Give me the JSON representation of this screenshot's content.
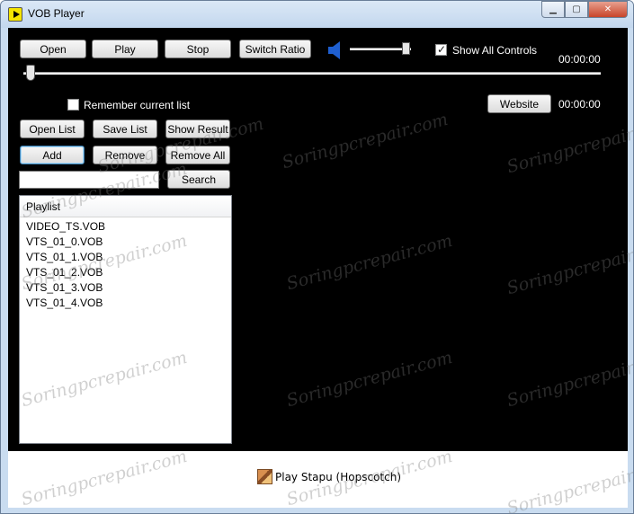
{
  "window": {
    "title": "VOB Player",
    "controls": {
      "minimize": "▁",
      "maximize": "▢",
      "close": "✕"
    }
  },
  "toolbar": {
    "open": "Open",
    "play": "Play",
    "stop": "Stop",
    "switch_ratio": "Switch Ratio",
    "show_all_controls": {
      "label": "Show All Controls",
      "checked": true
    },
    "time_top": "00:00:00",
    "time_bottom": "00:00:00",
    "website": "Website",
    "remember_list": {
      "label": "Remember current list",
      "checked": false
    }
  },
  "list_buttons": {
    "open_list": "Open List",
    "save_list": "Save List",
    "show_result": "Show Result",
    "add": "Add",
    "remove": "Remove",
    "remove_all": "Remove All",
    "search": "Search"
  },
  "search": {
    "value": ""
  },
  "playlist": {
    "header": "Playlist",
    "items": [
      "VIDEO_TS.VOB",
      "VTS_01_0.VOB",
      "VTS_01_1.VOB",
      "VTS_01_2.VOB",
      "VTS_01_3.VOB",
      "VTS_01_4.VOB"
    ]
  },
  "status": {
    "now_playing": "Play Stapu (Hopscotch)"
  },
  "watermark": "Soringpcrepair.com",
  "icons": {
    "app": "play-icon",
    "speaker": "speaker-icon",
    "now_playing": "thumbnail-icon"
  },
  "colors": {
    "video_area": "#000000",
    "accent": "#3c7fb1"
  }
}
